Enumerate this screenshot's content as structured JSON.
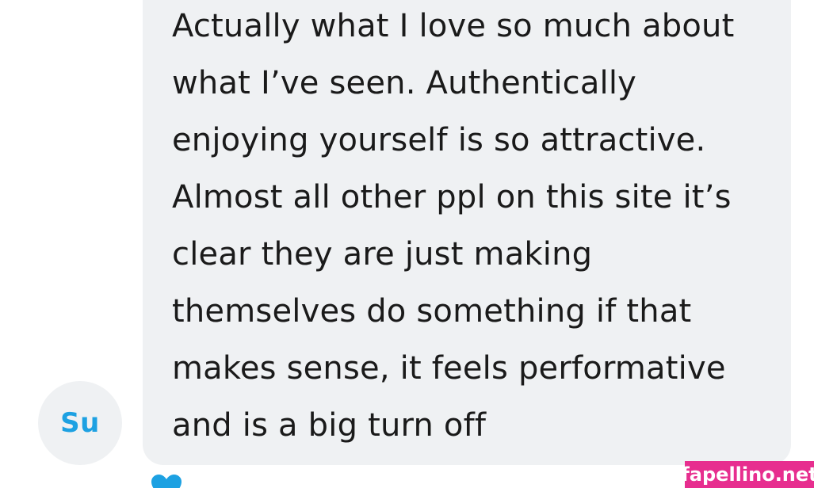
{
  "comment": {
    "lines": [
      "Actually what I love so much about",
      "what I’ve seen. Authentically",
      "enjoying yourself is so attractive.",
      "Almost all other ppl on this site it’s",
      "clear they are just making",
      "themselves do something if that",
      "makes sense, it feels performative",
      "and is a big turn off"
    ],
    "author_initials": "Su",
    "like_icon": "heart-icon"
  },
  "watermark": {
    "text": "fapellino.net"
  },
  "colors": {
    "bubble_background": "#eff1f3",
    "text": "#1a1a1a",
    "avatar_initials": "#1da1e2",
    "heart": "#1da1e2",
    "watermark_background": "#e72e8f",
    "watermark_text": "#ffffff"
  }
}
